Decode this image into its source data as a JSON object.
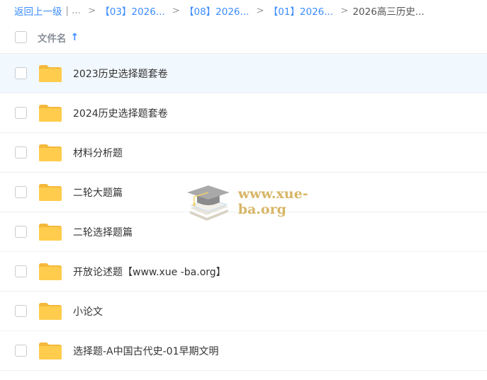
{
  "breadcrumb": {
    "back_label": "返回上一级",
    "pipe": "|",
    "dots": "...",
    "separator": ">",
    "crumbs": [
      "【03】2026...",
      "【08】2026...",
      "【01】2026..."
    ],
    "current": "2026高三历史..."
  },
  "header": {
    "filename_label": "文件名",
    "sort_icon": "↑"
  },
  "files": [
    {
      "name": "2023历史选择题套卷",
      "icon": "folder-icon"
    },
    {
      "name": "2024历史选择题套卷",
      "icon": "folder-icon"
    },
    {
      "name": "材料分析题",
      "icon": "folder-icon"
    },
    {
      "name": "二轮大题篇",
      "icon": "folder-icon"
    },
    {
      "name": "二轮选择题篇",
      "icon": "folder-icon"
    },
    {
      "name": "开放论述题【www.xue -ba.org】",
      "icon": "folder-icon"
    },
    {
      "name": "小论文",
      "icon": "folder-icon"
    },
    {
      "name": "选择题-A中国古代史-01早期文明",
      "icon": "folder-icon"
    }
  ],
  "watermark": {
    "text": "www.xue-ba.org"
  },
  "colors": {
    "accent": "#3b8cff",
    "folder": "#ffcc4d",
    "row_hover": "#f1f8fe",
    "watermark": "#d7b667"
  }
}
